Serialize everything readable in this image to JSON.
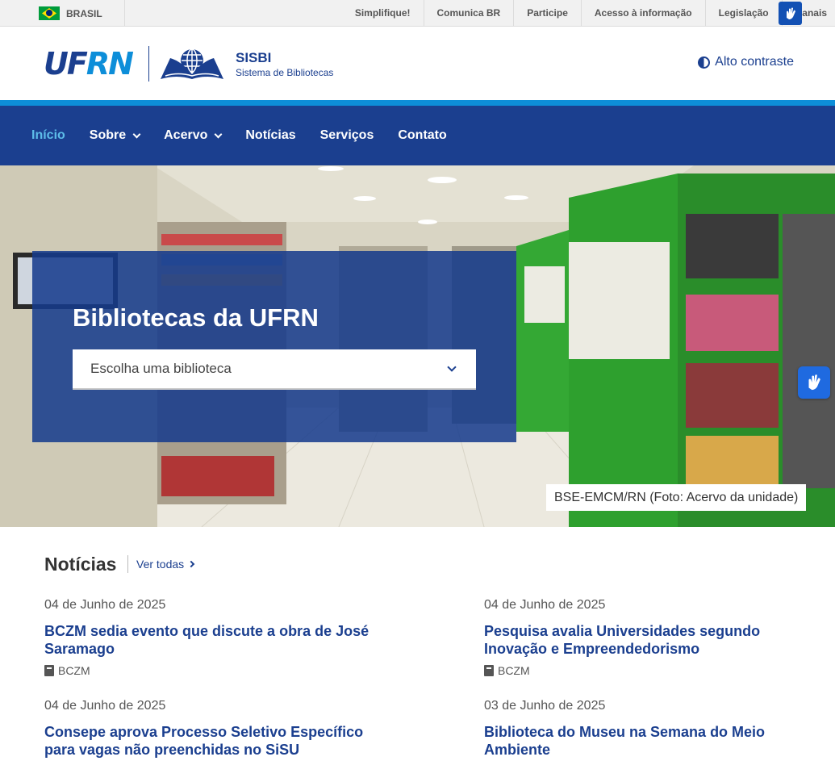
{
  "govbar": {
    "country": "BRASIL",
    "links": [
      "Simplifique!",
      "Comunica BR",
      "Participe",
      "Acesso à informação",
      "Legislação",
      "Canais"
    ],
    "icons": {
      "flag": "brazil-flag-icon",
      "vlibras": "sign-language-hands-icon"
    }
  },
  "header": {
    "logo_text_a": "UF",
    "logo_text_b": "RN",
    "title": "SISBI",
    "subtitle": "Sistema de Bibliotecas",
    "contrast_label": "Alto contraste"
  },
  "nav": {
    "items": [
      {
        "label": "Início",
        "active": true,
        "dropdown": false
      },
      {
        "label": "Sobre",
        "active": false,
        "dropdown": true
      },
      {
        "label": "Acervo",
        "active": false,
        "dropdown": true
      },
      {
        "label": "Notícias",
        "active": false,
        "dropdown": false
      },
      {
        "label": "Serviços",
        "active": false,
        "dropdown": false
      },
      {
        "label": "Contato",
        "active": false,
        "dropdown": false
      }
    ]
  },
  "hero": {
    "title": "Bibliotecas da UFRN",
    "select_placeholder": "Escolha uma biblioteca",
    "caption": "BSE-EMCM/RN (Foto: Acervo da unidade)"
  },
  "news": {
    "title": "Notícias",
    "see_all": "Ver todas",
    "items": [
      {
        "date": "04 de Junho de 2025",
        "headline": "BCZM sedia evento que discute a obra de José Saramago",
        "tag": "BCZM"
      },
      {
        "date": "04 de Junho de 2025",
        "headline": "Pesquisa avalia Universidades segundo Inovação e Empreendedorismo",
        "tag": "BCZM"
      },
      {
        "date": "04 de Junho de 2025",
        "headline": "Consepe aprova Processo Seletivo Específico para vagas não preenchidas no SiSU",
        "tag": ""
      },
      {
        "date": "03 de Junho de 2025",
        "headline": "Biblioteca do Museu na Semana do Meio Ambiente",
        "tag": ""
      }
    ]
  },
  "colors": {
    "primary": "#1b3f8f",
    "accent": "#0d8ed9",
    "active_nav": "#5dbde9",
    "shelf_green": "#2ea02e"
  }
}
